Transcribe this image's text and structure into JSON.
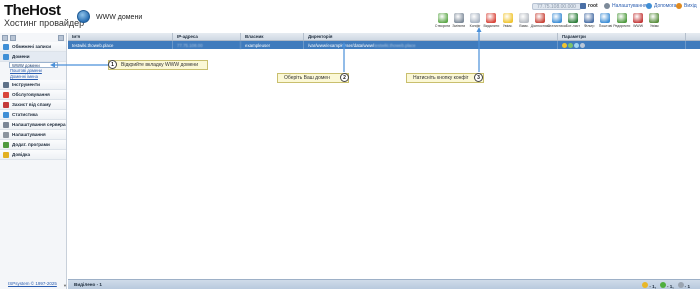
{
  "brand": {
    "name": "TheHost",
    "tagline": "Хостинг провайдер"
  },
  "page": {
    "title": "WWW домени"
  },
  "topbar": {
    "ip": "77.75.108.00.000",
    "user": "root",
    "links": [
      {
        "label": "Налаштування",
        "icon": "gear-icon"
      },
      {
        "label": "Допомога",
        "icon": "help-icon"
      },
      {
        "label": "Вихід",
        "icon": "exit-icon"
      }
    ]
  },
  "toolbar": [
    {
      "label": "Створити",
      "icon": "create-icon",
      "color": "#5ea84a"
    },
    {
      "label": "Змінити",
      "icon": "edit-icon",
      "color": "#7d8a99"
    },
    {
      "label": "Конфіг",
      "icon": "config-icon",
      "color": "#a9b4c2"
    },
    {
      "label": "Видалити",
      "icon": "delete-icon",
      "color": "#d9463b"
    },
    {
      "label": "Увімк.",
      "icon": "bulb-on-icon",
      "color": "#f0c531"
    },
    {
      "label": "Вимк.",
      "icon": "bulb-off-icon",
      "color": "#b7bcc3"
    },
    {
      "label": "Діагностика",
      "icon": "diagnostics-icon",
      "color": "#c9463b"
    },
    {
      "label": "Статистика",
      "icon": "stats-icon",
      "color": "#3f8fd6"
    },
    {
      "label": "Бот-лист",
      "icon": "botlist-icon",
      "color": "#2f7f3c"
    },
    {
      "label": "Фільтр",
      "icon": "filter-icon",
      "color": "#4a6fa5"
    },
    {
      "label": "Поштові",
      "icon": "mail-icon",
      "color": "#3f8fd6"
    },
    {
      "label": "Редиректи",
      "icon": "redirect-icon",
      "color": "#4f9a3e"
    },
    {
      "label": "WWW",
      "icon": "www-icon",
      "color": "#c43a3a"
    },
    {
      "label": "Увімк",
      "icon": "enable-icon",
      "color": "#5a8f3e"
    }
  ],
  "sidebar": {
    "items": [
      {
        "label": "Обмежені записи",
        "icon": "records-icon",
        "color": "#3f8fd6"
      },
      {
        "label": "Домени",
        "icon": "domains-icon",
        "color": "#3f8fd6",
        "open": true,
        "children": [
          "WWW домени",
          "Поштові домени",
          "Доменні імена"
        ]
      },
      {
        "label": "Інструменти",
        "icon": "tools-icon",
        "color": "#5e7188"
      },
      {
        "label": "Обслуговування",
        "icon": "service-icon",
        "color": "#d9463b"
      },
      {
        "label": "Захист від спаму",
        "icon": "spam-icon",
        "color": "#c43a3a"
      },
      {
        "label": "Статистика",
        "icon": "statistics-icon",
        "color": "#3f8fd6"
      },
      {
        "label": "Налаштування сервера",
        "icon": "server-icon",
        "color": "#7a8696"
      },
      {
        "label": "Налаштування",
        "icon": "settings-icon",
        "color": "#8b949e"
      },
      {
        "label": "Додат. програми",
        "icon": "apps-icon",
        "color": "#4f9a3e"
      },
      {
        "label": "Довідка",
        "icon": "help-book-icon",
        "color": "#e2b021"
      }
    ],
    "footer": "ISPsystem © 1997-2025"
  },
  "grid": {
    "columns": [
      "Ім'я",
      "IP-адреса",
      "Власник",
      "Директорія",
      "Параметри"
    ],
    "rows": [
      {
        "name": "testwiki.thoweb.place",
        "ip": "77.75.108.00",
        "owner": "exampleuser",
        "dir_prefix": "/var/www/exampleuser/data/www/",
        "dir_suffix": "testwiki.thoweb.place"
      }
    ],
    "footer": "Виділено - 1",
    "stats": [
      {
        "value": "1",
        "icon": "stat-yellow-icon",
        "color": "#e8b728"
      },
      {
        "value": "1",
        "icon": "stat-green-icon",
        "color": "#4fae3e"
      },
      {
        "value": "1",
        "icon": "stat-grey-icon",
        "color": "#9aa4b0"
      }
    ]
  },
  "callouts": [
    {
      "num": "1",
      "text": "Відкрийте вкладку WWW домени"
    },
    {
      "num": "2",
      "text": "Оберіть Ваш домен"
    },
    {
      "num": "3",
      "text": "Натисніть кнопку конфіг"
    }
  ]
}
